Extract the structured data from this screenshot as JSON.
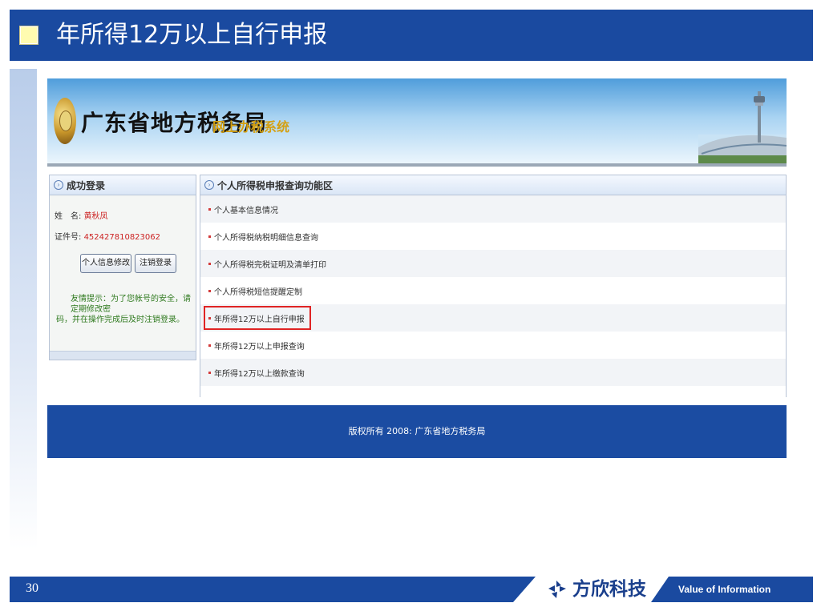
{
  "slide": {
    "title": "年所得12万以上自行申报",
    "page_number": "30",
    "company_name": "方欣科技",
    "tagline": "Value of Information"
  },
  "site": {
    "bureau_name": "广东省地方税务局",
    "system_name": "网上办税系统",
    "footer": "版权所有 2008: 广东省地方税务局"
  },
  "login_panel": {
    "title": "成功登录",
    "name_label": "姓　名:",
    "name_value": "黄秋凤",
    "id_label": "证件号:",
    "id_value": "452427810823062",
    "edit_button": "个人信息修改",
    "logout_button": "注销登录",
    "tip_line1": "友情提示：为了您帐号的安全，请定期修改密",
    "tip_line2": "码，并在操作完成后及时注销登录。"
  },
  "function_panel": {
    "title": "个人所得税申报查询功能区",
    "items": [
      "个人基本信息情况",
      "个人所得税纳税明细信息查询",
      "个人所得税完税证明及清单打印",
      "个人所得税短信提醒定制",
      "年所得12万以上自行申报",
      "年所得12万以上申报查询",
      "年所得12万以上缴款查询"
    ],
    "selected_index": 4
  },
  "colors": {
    "title_bar": "#1a4aa0",
    "highlight": "#e02424",
    "site_footer": "#1b4ca2"
  }
}
